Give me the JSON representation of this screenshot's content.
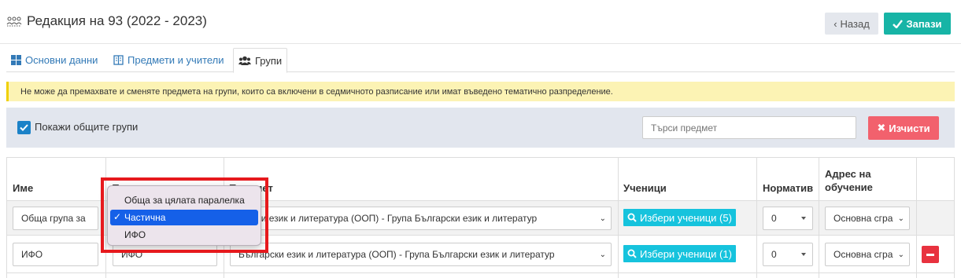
{
  "header": {
    "title": "Редакция на 93 (2022 - 2023)",
    "back_label": "Назад",
    "save_label": "Запази"
  },
  "tabs": [
    {
      "label": "Основни данни",
      "icon": "grid-icon"
    },
    {
      "label": "Предмети и учители",
      "icon": "book-icon"
    },
    {
      "label": "Групи",
      "icon": "users-icon",
      "active": true
    }
  ],
  "alert": {
    "text": "Не може да премахвате и сменяте предмета на групи, които са включени в седмичното разписание или имат въведено тематично разпределение."
  },
  "filters": {
    "show_common_label": "Покажи общите групи",
    "show_common_checked": true,
    "search_placeholder": "Търси предмет",
    "clear_label": "Изчисти"
  },
  "table": {
    "headers": {
      "name": "Име",
      "type": "Тип",
      "subject": "Предмет",
      "students": "Ученици",
      "norm": "Норматив",
      "address_line1": "Адрес на",
      "address_line2": "обучение"
    },
    "rows": [
      {
        "name": "Обща група за",
        "type": "Частична",
        "subject": "Български език и литература (ООП) - Група Български език и литература",
        "subject_visible": "гарски език и литература (ООП) - Група Български език и литератур",
        "students_label": "Избери ученици (5)",
        "norm": "0",
        "address": "Основна сгра"
      },
      {
        "name": "ИФО",
        "type": "ИФО",
        "subject": "Български език и литература (ООП) - Група Български език и литература",
        "subject_visible": "Български език и литература (ООП) - Група Български език и литератур",
        "students_label": "Избери ученици (1)",
        "norm": "0",
        "address": "Основна сгра"
      }
    ]
  },
  "type_dropdown": {
    "options": [
      "Обща за цялата паралелка",
      "Частична",
      "ИФО"
    ],
    "selected": "Частична",
    "check": "✓"
  },
  "colors": {
    "save": "#17b4a6",
    "clear": "#f2616d",
    "students_button": "#16c3dd",
    "remove": "#e8323f",
    "alert_bg": "#fcf3b4",
    "dropdown_selected": "#1560e8",
    "highlight_box": "#e6191d"
  }
}
